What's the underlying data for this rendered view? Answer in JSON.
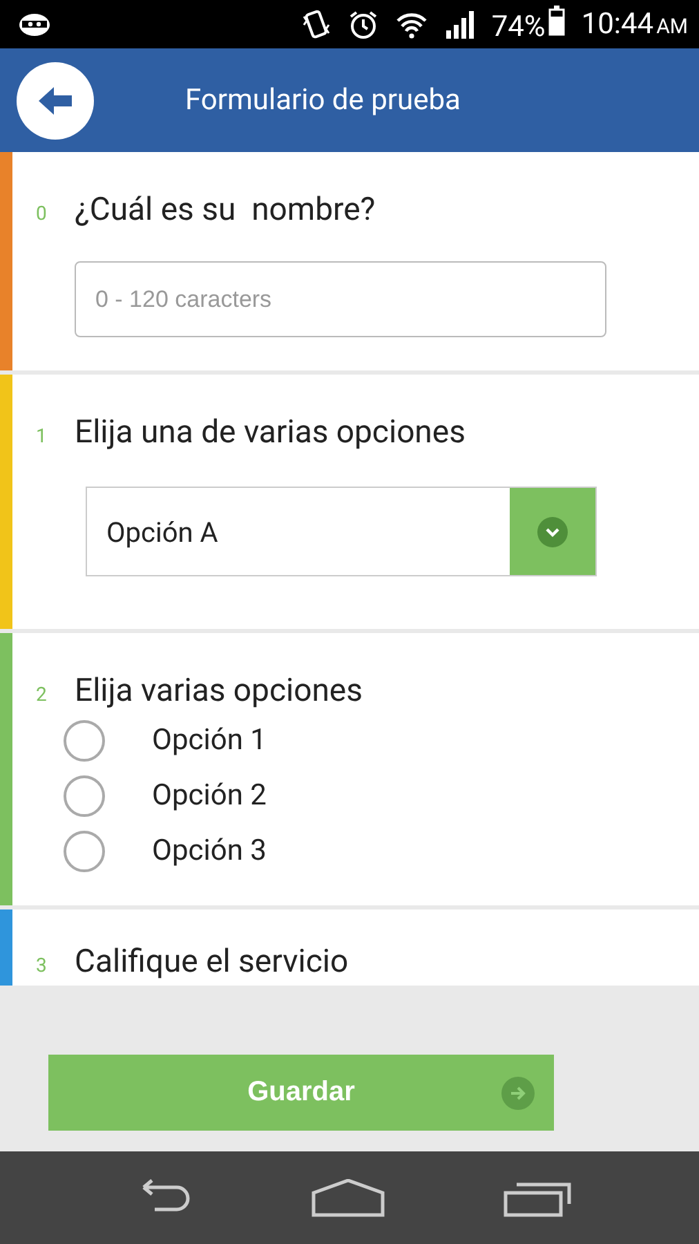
{
  "status_bar": {
    "battery": "74%",
    "time": "10:44",
    "meridiem": "AM"
  },
  "header": {
    "title": "Formulario de prueba"
  },
  "questions": [
    {
      "number": "0",
      "title": "¿Cuál es su  nombre?",
      "kind": "text",
      "color": "#e8822a",
      "placeholder": "0 - 120 caracters"
    },
    {
      "number": "1",
      "title": "Elija una de varias opciones",
      "kind": "dropdown",
      "color": "#f1c419",
      "value": "Opción A"
    },
    {
      "number": "2",
      "title": "Elija varias opciones",
      "kind": "radio",
      "color": "#7dc05f",
      "options": [
        {
          "label": "Opción 1",
          "selected": false
        },
        {
          "label": "Opción 2",
          "selected": false
        },
        {
          "label": "Opción 3",
          "selected": false
        }
      ]
    },
    {
      "number": "3",
      "title": "Califique el servicio",
      "kind": "heading",
      "color": "#2f95dc"
    }
  ],
  "footer": {
    "button": "Guardar"
  }
}
